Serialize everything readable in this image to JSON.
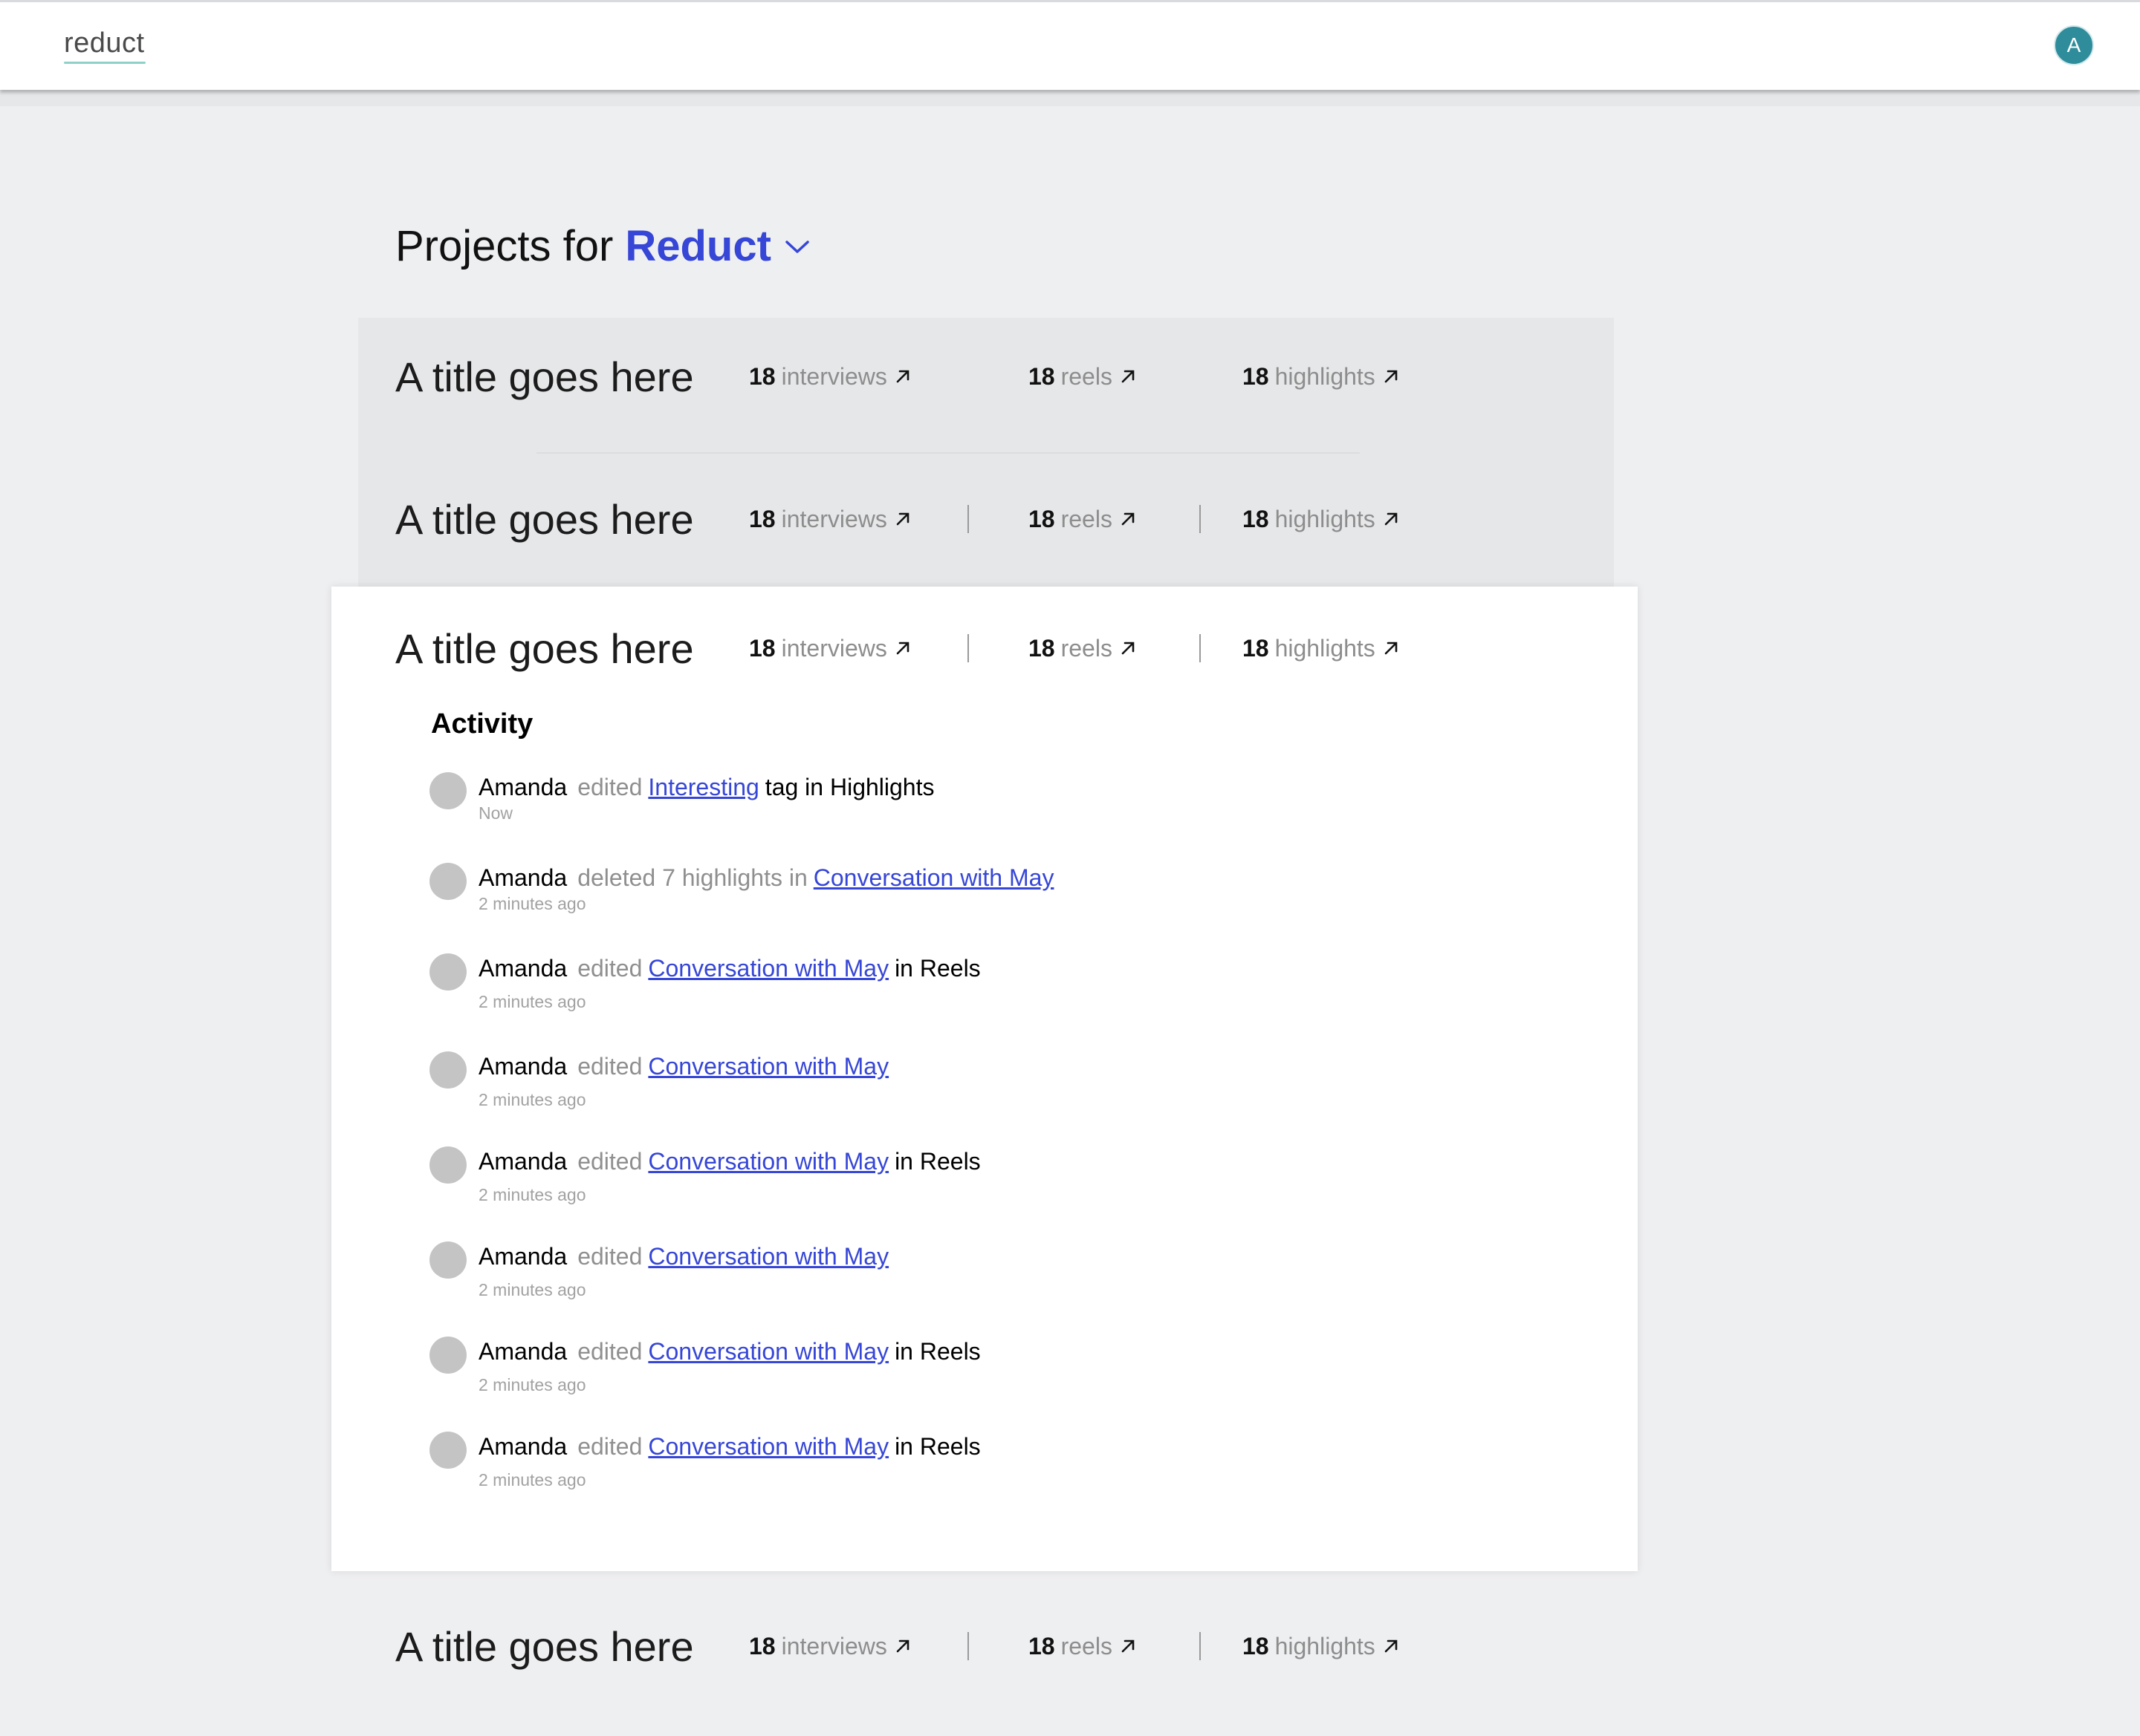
{
  "app": {
    "logo": "reduct",
    "user_initial": "A"
  },
  "heading": {
    "prefix": "Projects for",
    "org": "Reduct"
  },
  "projects": [
    {
      "title": "A title goes here",
      "interviews_count": "18",
      "interviews_label": "interviews",
      "reels_count": "18",
      "reels_label": "reels",
      "highlights_count": "18",
      "highlights_label": "highlights"
    },
    {
      "title": "A title goes here",
      "interviews_count": "18",
      "interviews_label": "interviews",
      "reels_count": "18",
      "reels_label": "reels",
      "highlights_count": "18",
      "highlights_label": "highlights"
    },
    {
      "title": "A title goes here",
      "interviews_count": "18",
      "interviews_label": "interviews",
      "reels_count": "18",
      "reels_label": "reels",
      "highlights_count": "18",
      "highlights_label": "highlights"
    },
    {
      "title": "A title goes here",
      "interviews_count": "18",
      "interviews_label": "interviews",
      "reels_count": "18",
      "reels_label": "reels",
      "highlights_count": "18",
      "highlights_label": "highlights"
    }
  ],
  "activity": {
    "title": "Activity",
    "items": [
      {
        "user": "Amanda",
        "verb": "edited",
        "link": "Interesting",
        "rest": "tag in Highlights",
        "time": "Now"
      },
      {
        "user": "Amanda",
        "verb": "deleted 7 highlights in",
        "link": "Conversation with May",
        "rest": "",
        "time": "2 minutes ago"
      },
      {
        "user": "Amanda",
        "verb": "edited",
        "link": "Conversation with May",
        "rest": "in Reels",
        "time": "2 minutes ago"
      },
      {
        "user": "Amanda",
        "verb": "edited",
        "link": "Conversation with May",
        "rest": "",
        "time": "2 minutes ago"
      },
      {
        "user": "Amanda",
        "verb": "edited",
        "link": "Conversation with May",
        "rest": "in Reels",
        "time": "2 minutes ago"
      },
      {
        "user": "Amanda",
        "verb": "edited",
        "link": "Conversation with May",
        "rest": "",
        "time": "2 minutes ago"
      },
      {
        "user": "Amanda",
        "verb": "edited",
        "link": "Conversation with May",
        "rest": "in Reels",
        "time": "2 minutes ago"
      },
      {
        "user": "Amanda",
        "verb": "edited",
        "link": "Conversation with May",
        "rest": "in Reels",
        "time": "2 minutes ago"
      }
    ]
  },
  "colors": {
    "accent": "#3646d6",
    "avatar": "#2f8c9b",
    "logo_underline": "#8fd1c8"
  }
}
